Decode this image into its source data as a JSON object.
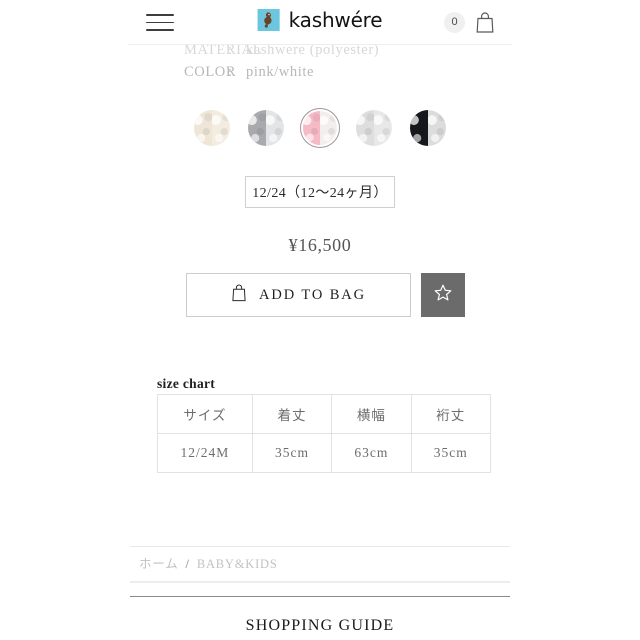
{
  "header": {
    "menu_icon": "hamburger-menu-icon",
    "brand_name": "kashwére",
    "brand_mark_icon": "kashwere-monkey-logo-icon",
    "cart_count": "0",
    "cart_icon": "shopping-bag-icon"
  },
  "specs": [
    {
      "label": "MATERIAL",
      "colon": ":",
      "value": "kashwere (polyester)",
      "clipped": true
    },
    {
      "label": "COLOR",
      "colon": ":",
      "value": "pink/white",
      "clipped": false
    }
  ],
  "swatches": [
    {
      "name": "swatch-cream",
      "left_color": "#efe6d8",
      "right_color": "#f3ece1",
      "selected": false
    },
    {
      "name": "swatch-grey-white",
      "left_color": "#a8aaad",
      "right_color": "#e3e4e6",
      "selected": false
    },
    {
      "name": "swatch-pink-white",
      "left_color": "#f6b9c6",
      "right_color": "#f2eeec",
      "selected": true
    },
    {
      "name": "swatch-light-grey",
      "left_color": "#dedede",
      "right_color": "#e8e8e8",
      "selected": false
    },
    {
      "name": "swatch-black-white",
      "left_color": "#16181c",
      "right_color": "#dcdcdc",
      "selected": false
    }
  ],
  "size_selector": {
    "value": "12/24（12〜24ヶ月）"
  },
  "price": "¥16,500",
  "actions": {
    "add_to_bag_label": "ADD TO BAG",
    "add_to_bag_icon": "shopping-bag-icon",
    "favorite_icon": "star-outline-icon",
    "favorite_color": "#6b6b6b"
  },
  "size_chart": {
    "title": "size chart",
    "headers": [
      "サイズ",
      "着丈",
      "横幅",
      "裄丈"
    ],
    "rows": [
      [
        "12/24M",
        "35cm",
        "63cm",
        "35cm"
      ]
    ]
  },
  "breadcrumb": {
    "home": "ホーム",
    "separator": "/",
    "current": "BABY&KIDS"
  },
  "footer": {
    "shopping_guide": "SHOPPING GUIDE"
  }
}
